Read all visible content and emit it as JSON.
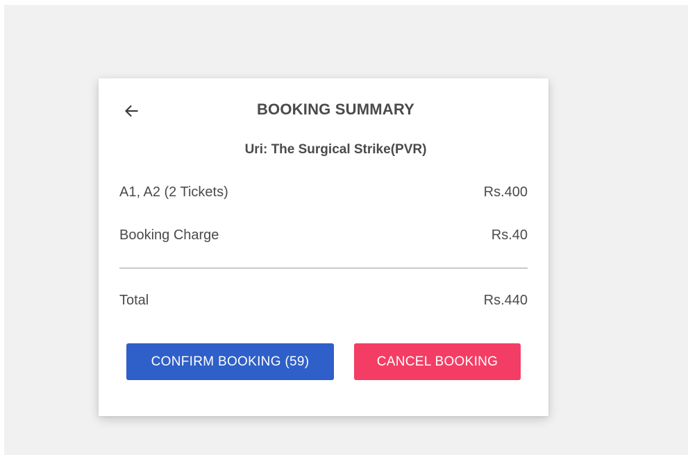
{
  "summary": {
    "title": "BOOKING SUMMARY",
    "movie": "Uri: The Surgical Strike(PVR)",
    "tickets_label": "A1, A2 (2 Tickets)",
    "tickets_price": "Rs.400",
    "charge_label": "Booking Charge",
    "charge_price": "Rs.40",
    "total_label": "Total",
    "total_price": "Rs.440"
  },
  "actions": {
    "confirm_label": "CONFIRM BOOKING (59)",
    "cancel_label": "CANCEL BOOKING"
  },
  "icons": {
    "back": "arrow-left-icon"
  },
  "colors": {
    "confirm": "#2f5fc8",
    "cancel": "#f43d64",
    "text": "#4a4a4a",
    "background": "#f1f1f1"
  }
}
